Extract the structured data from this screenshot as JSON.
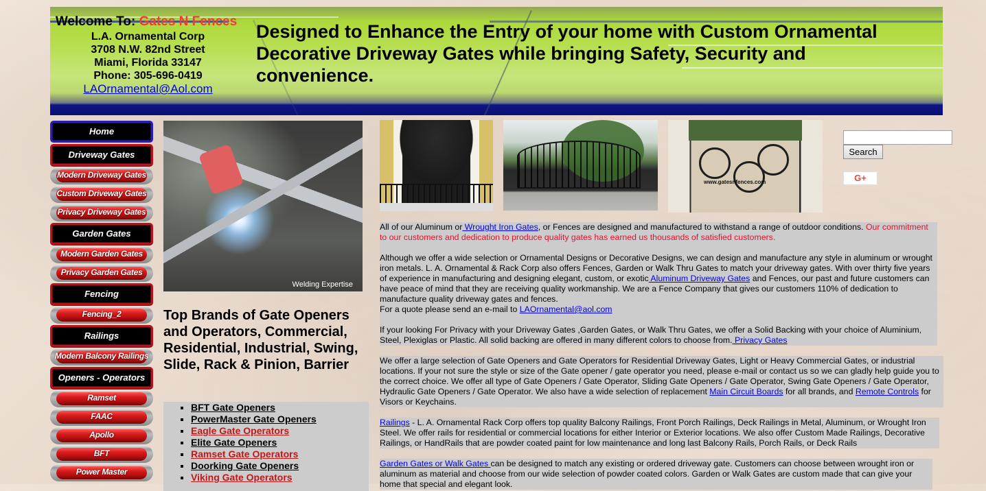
{
  "header": {
    "welcome_prefix": "Welcome To: ",
    "welcome_brand": "Gates N Fences",
    "company": "L.A. Ornamental Corp",
    "street": "3708 N.W. 82nd Street",
    "city": "Miami, Florida 33147",
    "phone": "Phone: 305-696-0419",
    "email": "LAOrnamental@Aol.com",
    "tagline": "Designed to Enhance the Entry of your home with Custom Ornamental Decorative Driveway Gates while bringing Safety, Security and convenience."
  },
  "nav": {
    "items": [
      {
        "label": "Home",
        "type": "main",
        "accent": "blue"
      },
      {
        "label": "Driveway Gates",
        "type": "main"
      },
      {
        "label": "Modern Driveway Gates",
        "type": "sub"
      },
      {
        "label": "Custom Driveway Gates",
        "type": "sub"
      },
      {
        "label": "Privacy Driveway Gates",
        "type": "sub"
      },
      {
        "label": "Garden Gates",
        "type": "main"
      },
      {
        "label": "Modern Garden Gates",
        "type": "sub"
      },
      {
        "label": "Privacy Garden Gates",
        "type": "sub"
      },
      {
        "label": "Fencing",
        "type": "main"
      },
      {
        "label": "Fencing_2",
        "type": "sub"
      },
      {
        "label": "Railings",
        "type": "main"
      },
      {
        "label": "Modern Balcony Railings",
        "type": "sub"
      },
      {
        "label": "Openers - Operators",
        "type": "main"
      },
      {
        "label": "Ramset",
        "type": "sub"
      },
      {
        "label": "FAAC",
        "type": "sub"
      },
      {
        "label": "Apollo",
        "type": "sub"
      },
      {
        "label": "BFT",
        "type": "sub"
      },
      {
        "label": "Power Master",
        "type": "sub"
      }
    ]
  },
  "welder_image": {
    "caption": "Welding Expertise"
  },
  "brands": {
    "heading": "Top Brands of Gate Openers and Operators, Commercial, Residential, Industrial, Swing, Slide, Rack & Pinion, Barrier",
    "links": [
      {
        "label": "BFT Gate Openers",
        "color": "black"
      },
      {
        "label": "PowerMaster Gate Openers",
        "color": "black"
      },
      {
        "label": "Eagle Gate Operators",
        "color": "red"
      },
      {
        "label": "Elite Gate Openers",
        "color": "black"
      },
      {
        "label": "Ramset Gate Operators",
        "color": "red"
      },
      {
        "label": "Doorking Gate Openers",
        "color": "black"
      },
      {
        "label": "Viking Gate Operators",
        "color": "red"
      }
    ]
  },
  "gallery": {
    "photo3_watermark": "www.gatesnfences.com"
  },
  "search": {
    "input_value": "",
    "button_label": "Search",
    "gplus_label": "G+"
  },
  "content": {
    "p1": {
      "t1": "All of our Aluminum or",
      "link1": " Wrought Iron Gates",
      "t2": ", or Fences are designed and manufactured to withstand a range of outdoor conditions. ",
      "red": "Our commitment to our customers and dedication to produce quality gates has earned us thousands of satisfied customers."
    },
    "p2": {
      "t1": "Although we offer a wide selection or Ornamental Designs or Decorative Designs, we can design and manufacture any style in aluminum or wrought iron metals. L. A. Ornamental & Rack Corp also offers Fences, Garden or Walk Thru Gates to match your driveway  gates. With over thirty five years of experience in manufacturing and designing elegant, custom, or exotic",
      "link1": " Aluminum Driveway Gates",
      "t2": " and Fences, our past and future customers can have peace of mind that they are receiving quality workmanship.  We are a Fence Company that gives our customers 110% of dedication to manufacture quality driveway gates and fences.",
      "t3": "For a quote please send an e-mail to ",
      "email": "LAOrnamental@aol.com"
    },
    "p3": {
      "t1": "If your looking For Privacy with your Driveway Gates ,Garden Gates, or Walk Thru Gates, we offer a Solid Backing with your choice of Aluminium, Steel, Plexiglas or Plastic.  All solid backing are offered in many different colors to choose from.",
      "link1": " Privacy Gates"
    },
    "p4": {
      "t1": "We offer a large selection of  Gate Openers and Gate Operators for Residential Driveway Gates, Light or Heavy Commercial Gates, or industrial locations. If your not sure the style or size of the Gate opener / gate operator  you need, please e-mail or contact us so we can gladly help guide you to the correct choice. We offer all type of Gate Openers / Gate Operator, Sliding Gate Openers / Gate Operator, Swing Gate Openers / Gate Operator, Hydraulic Gate Openers / Gate Operator. We also have a wide selection of replacement ",
      "link1": "Main Circuit Boards",
      "t2": " for all brands, and ",
      "link2": "Remote Controls",
      "t3": "  for Visors or Keychains."
    },
    "p5": {
      "link1": "Railings",
      "t1": " - L. A. Ornamental Rack Corp offers top quality Balcony Railings, Front Porch Railings, Deck Railings in Metal, Aluminum, or Wrought Iron Steel.  We offer rails for residential or commercial locations for either Interior or Exterior locations. We also offer Custom Made Railings, Decorative Railings, or HandRails that are powder coated paint for low maintenance and long last Balcony Rails, Porch Rails, or Deck Rails"
    },
    "p6": {
      "link1": "Garden Gates or Walk Gates ",
      "t1": "can be designed to match any existing or ordered driveway gate.  Customers can choose between wrought iron or aluminum as material  and choose from our wide selection of powder coated colors.  Garden or Walk Gates are custom made that can give your home that special and elegant look."
    }
  }
}
